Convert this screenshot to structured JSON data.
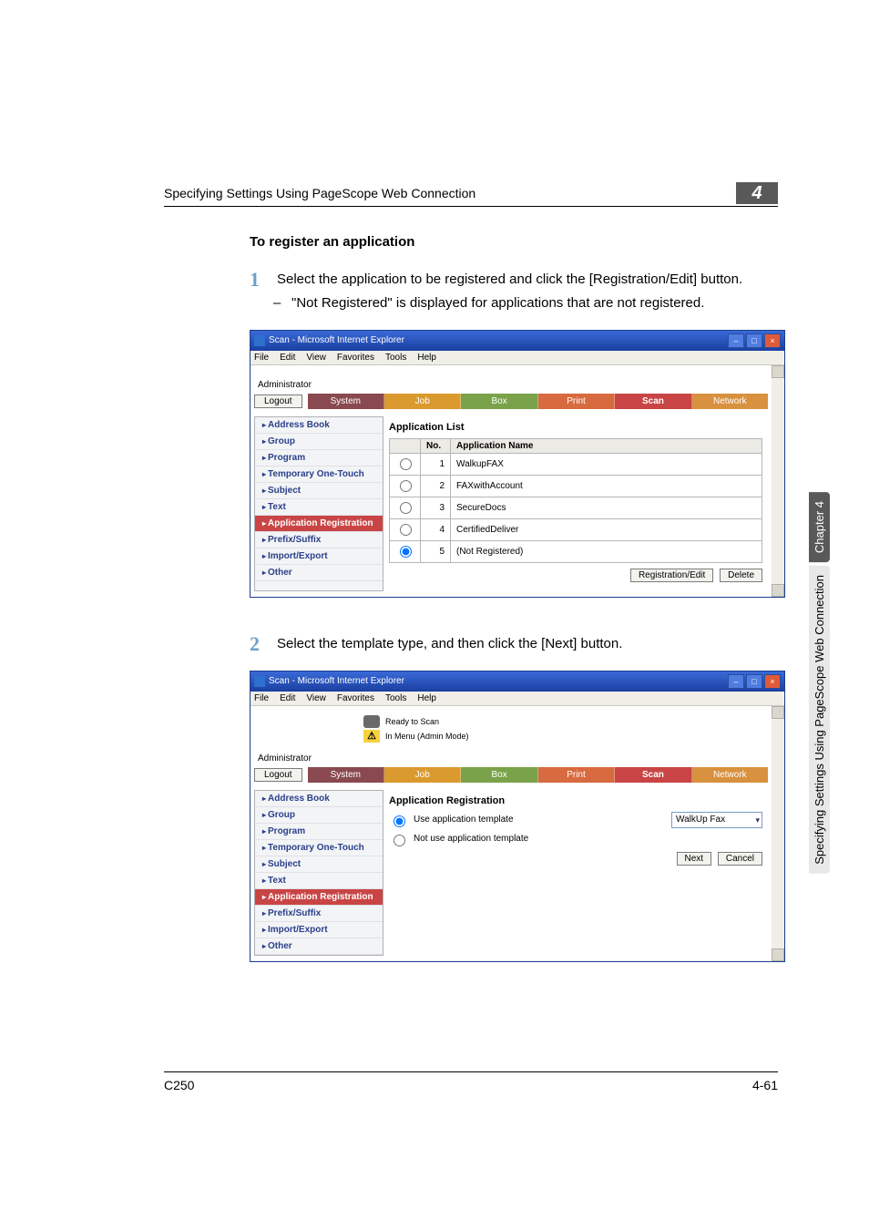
{
  "header": {
    "text": "Specifying Settings Using PageScope Web Connection",
    "chapter_number": "4"
  },
  "section_title": "To register an application",
  "steps": [
    {
      "num": "1",
      "body": "Select the application to be registered and click the [Registration/Edit] button.",
      "sub": "\"Not Registered\" is displayed for applications that are not registered."
    },
    {
      "num": "2",
      "body": "Select the template type, and then click the [Next] button.",
      "sub": null
    }
  ],
  "ie": {
    "title": "Scan - Microsoft Internet Explorer",
    "menu": [
      "File",
      "Edit",
      "View",
      "Favorites",
      "Tools",
      "Help"
    ],
    "admin": "Administrator",
    "logout": "Logout",
    "tabs": {
      "system": "System",
      "job": "Job",
      "box": "Box",
      "print": "Print",
      "scan": "Scan",
      "network": "Network"
    },
    "sidebar": [
      "Address Book",
      "Group",
      "Program",
      "Temporary One-Touch",
      "Subject",
      "Text",
      "Application Registration",
      "Prefix/Suffix",
      "Import/Export",
      "Other"
    ],
    "status": {
      "line1": "Ready to Scan",
      "line2": "In Menu (Admin Mode)"
    }
  },
  "app_list": {
    "heading": "Application List",
    "cols": {
      "no": "No.",
      "name": "Application Name"
    },
    "rows": [
      {
        "no": "1",
        "name": "WalkupFAX"
      },
      {
        "no": "2",
        "name": "FAXwithAccount"
      },
      {
        "no": "3",
        "name": "SecureDocs"
      },
      {
        "no": "4",
        "name": "CertifiedDeliver"
      },
      {
        "no": "5",
        "name": "(Not Registered)"
      }
    ],
    "selected_index": 4,
    "buttons": {
      "reg": "Registration/Edit",
      "del": "Delete"
    }
  },
  "app_reg": {
    "heading": "Application Registration",
    "opt_use": "Use application template",
    "opt_not": "Not use application template",
    "select_value": "WalkUp Fax",
    "buttons": {
      "next": "Next",
      "cancel": "Cancel"
    }
  },
  "side": {
    "dark": "Chapter 4",
    "light": "Specifying Settings Using PageScope Web Connection"
  },
  "footer": {
    "left": "C250",
    "right": "4-61"
  }
}
